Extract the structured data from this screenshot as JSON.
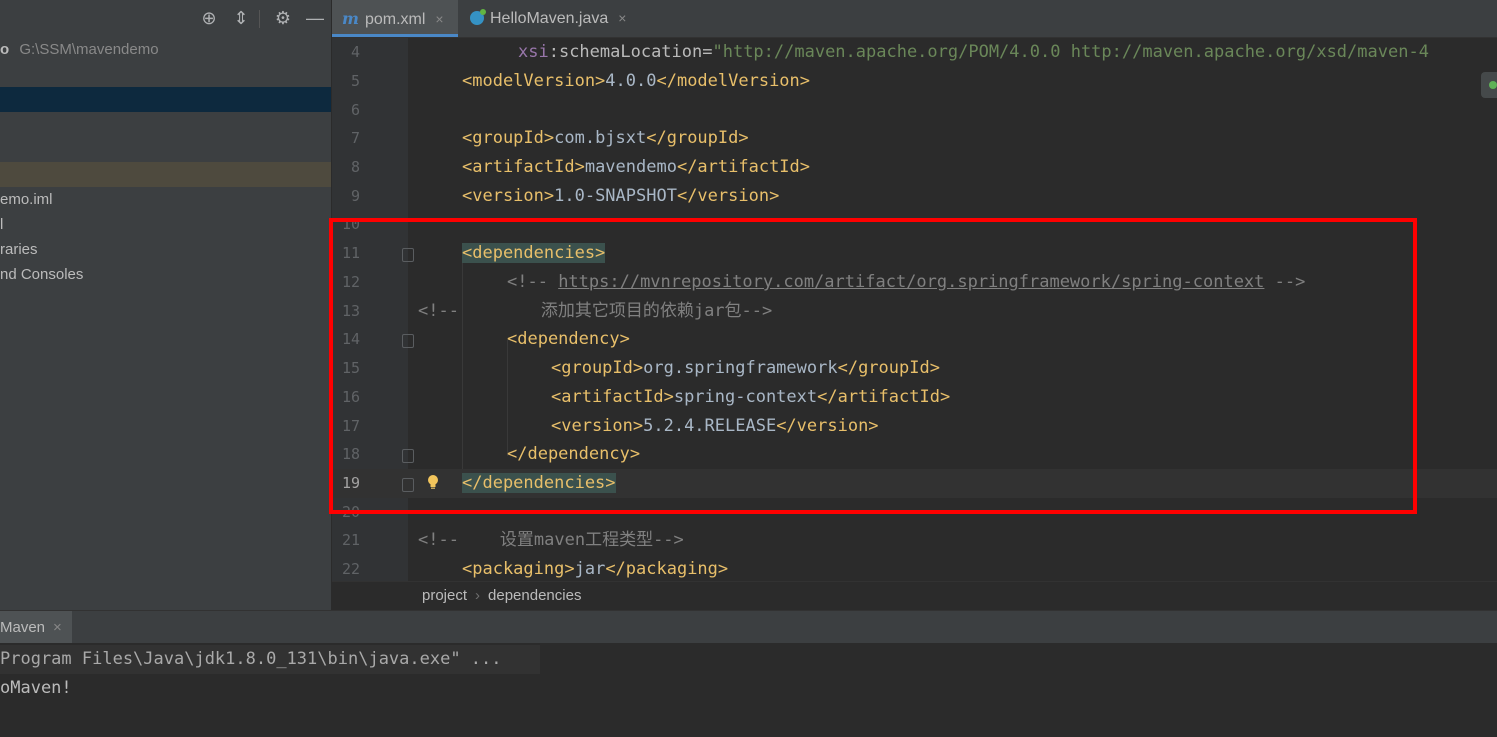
{
  "project_panel": {
    "toolbar_icons": [
      "locate-icon",
      "collapse-icon",
      "gear-icon",
      "minimize-icon"
    ],
    "root_name": "o",
    "root_path": "G:\\SSM\\mavendemo",
    "rows": [
      "",
      "",
      "emo.iml",
      "l",
      "raries",
      "nd Consoles"
    ]
  },
  "tabs": [
    {
      "icon": "maven-m-icon",
      "label": "pom.xml",
      "active": true
    },
    {
      "icon": "java-class-icon",
      "label": "HelloMaven.java",
      "active": false
    }
  ],
  "tab_close_glyph": "×",
  "editor": {
    "line_numbers": [
      "4",
      "5",
      "6",
      "7",
      "8",
      "9",
      "10",
      "11",
      "12",
      "13",
      "14",
      "15",
      "16",
      "17",
      "18",
      "19",
      "20",
      "21",
      "22"
    ],
    "lines": {
      "l4_ns": "xsi",
      "l4_attr": ":schemaLocation=",
      "l4_val": "\"http://maven.apache.org/POM/4.0.0 http://maven.apache.org/xsd/maven-4",
      "l5_open": "<modelVersion>",
      "l5_text": "4.0.0",
      "l5_close": "</modelVersion>",
      "l7_open": "<groupId>",
      "l7_text": "com.bjsxt",
      "l7_close": "</groupId>",
      "l8_open": "<artifactId>",
      "l8_text": "mavendemo",
      "l8_close": "</artifactId>",
      "l9_open": "<version>",
      "l9_text": "1.0-SNAPSHOT",
      "l9_close": "</version>",
      "l11": "<dependencies>",
      "l12_start": "<!-- ",
      "l12_link": "https://mvnrepository.com/artifact/org.springframework/spring-context",
      "l12_end": " -->",
      "l13_start": "<!--",
      "l13_text": "        添加其它项目的依赖jar包-->",
      "l14": "<dependency>",
      "l15_open": "<groupId>",
      "l15_text": "org.springframework",
      "l15_close": "</groupId>",
      "l16_open": "<artifactId>",
      "l16_text": "spring-context",
      "l16_close": "</artifactId>",
      "l17_open": "<version>",
      "l17_text": "5.2.4.RELEASE",
      "l17_close": "</version>",
      "l18": "</dependency>",
      "l19": "</dependencies>",
      "l21_start": "<!--",
      "l21_text": "    设置maven工程类型-->",
      "l22_open": "<packaging>",
      "l22_text": "jar",
      "l22_close": "</packaging>"
    },
    "current_line": "19"
  },
  "breadcrumb": [
    "project",
    "dependencies"
  ],
  "breadcrumb_sep": "›",
  "run_panel": {
    "tab_label": "Maven",
    "console": [
      "Program Files\\Java\\jdk1.8.0_131\\bin\\java.exe\" ...",
      "oMaven!"
    ]
  },
  "colors": {
    "highlight_box": "#ff0000",
    "xml_tag": "#e8bf6a",
    "xml_value": "#6a8759",
    "comment": "#808080"
  }
}
